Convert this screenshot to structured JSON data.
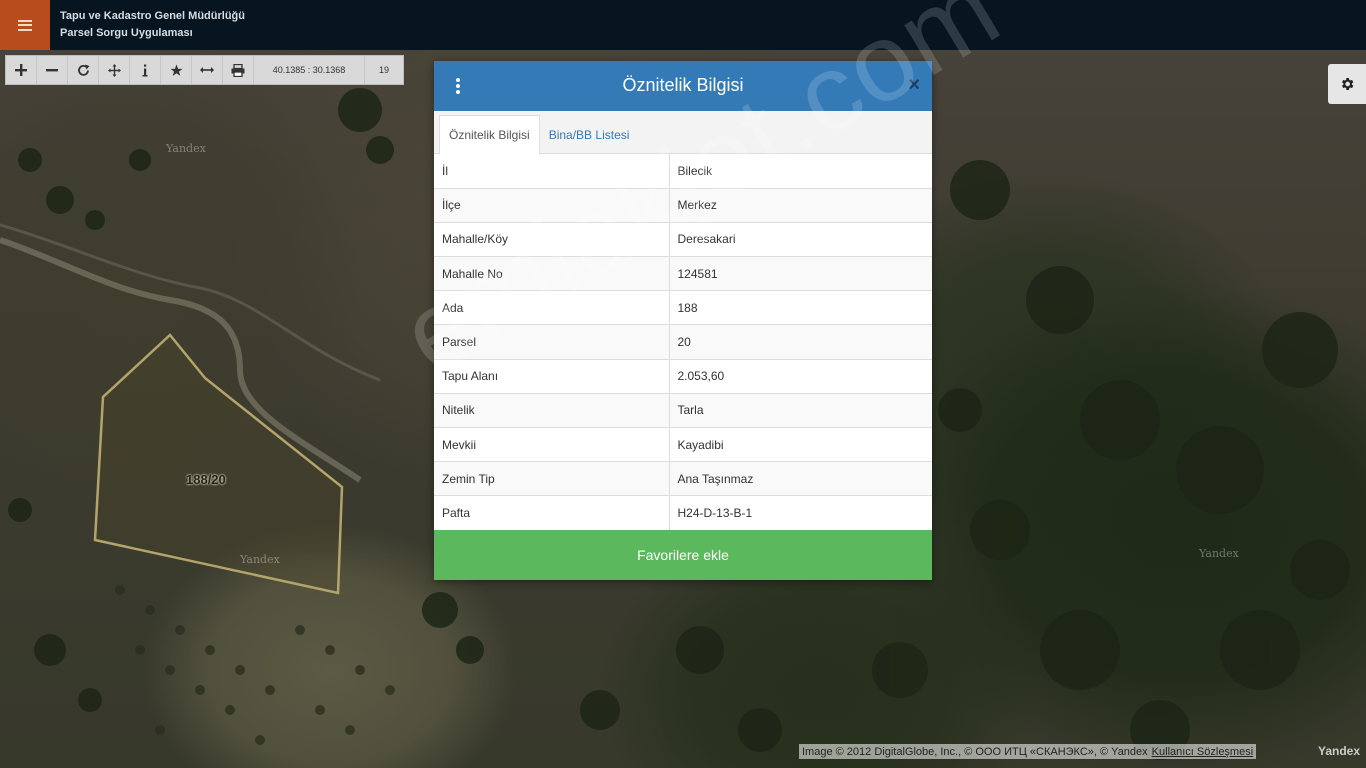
{
  "header": {
    "menu_icon": "hamburger-icon",
    "title_line1": "Tapu ve Kadastro Genel Müdürlüğü",
    "title_line2": "Parsel Sorgu Uygulaması",
    "accent_color": "#b84c1c",
    "bg_color": "#061520"
  },
  "toolbar": {
    "tools": [
      "zoom-in-icon",
      "zoom-out-icon",
      "refresh-icon",
      "pan-icon",
      "info-icon",
      "star-icon",
      "measure-icon",
      "print-icon"
    ],
    "coordinates": "40.1385 : 30.1368",
    "zoom_level": "19"
  },
  "settings": {
    "icon": "gear-icon"
  },
  "map": {
    "watermarks": [
      "Yandex",
      "Yandex",
      "Yandex"
    ],
    "parcel_label": "188/20",
    "site_watermark": "emlakjet.com"
  },
  "modal": {
    "title": "Öznitelik Bilgisi",
    "close_symbol": "×",
    "tabs": [
      {
        "label": "Öznitelik Bilgisi",
        "active": true
      },
      {
        "label": "Bina/BB Listesi",
        "active": false
      }
    ],
    "rows": [
      {
        "key": "İl",
        "value": "Bilecik"
      },
      {
        "key": "İlçe",
        "value": "Merkez"
      },
      {
        "key": "Mahalle/Köy",
        "value": "Deresakari"
      },
      {
        "key": "Mahalle No",
        "value": "124581"
      },
      {
        "key": "Ada",
        "value": "188"
      },
      {
        "key": "Parsel",
        "value": "20"
      },
      {
        "key": "Tapu Alanı",
        "value": "2.053,60"
      },
      {
        "key": "Nitelik",
        "value": "Tarla"
      },
      {
        "key": "Mevkii",
        "value": "Kayadibi"
      },
      {
        "key": "Zemin Tip",
        "value": "Ana Taşınmaz"
      },
      {
        "key": "Pafta",
        "value": "H24-D-13-B-1"
      }
    ],
    "favorite_button": "Favorilere ekle",
    "header_color": "#337ab7",
    "button_color": "#5cb85c"
  },
  "attribution": {
    "text": "Image © 2012 DigitalGlobe, Inc., © ООО ИТЦ «СКАНЭКС», © Yandex",
    "link": "Kullanıcı Sözleşmesi",
    "logo": "Yandex"
  }
}
